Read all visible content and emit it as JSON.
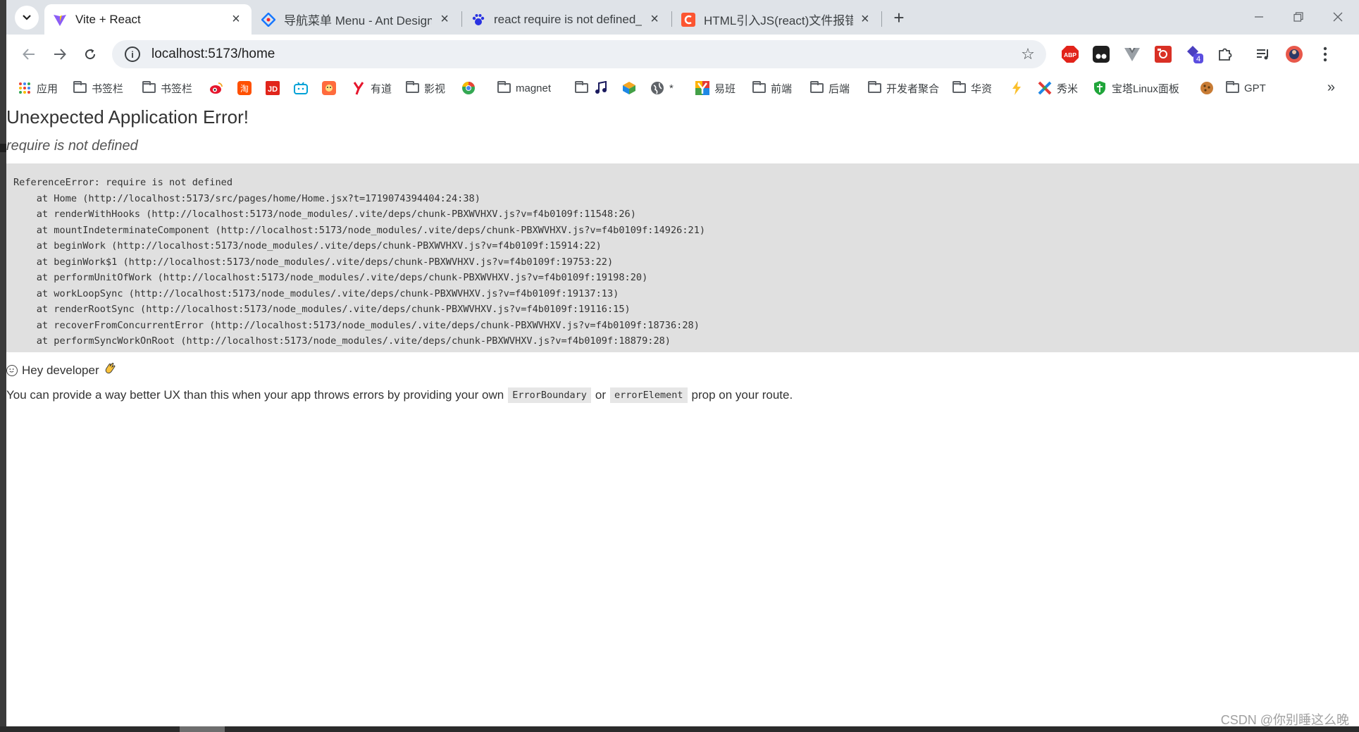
{
  "browser": {
    "tabs": [
      {
        "title": "Vite + React",
        "active": true
      },
      {
        "title": "导航菜单 Menu - Ant Design",
        "active": false
      },
      {
        "title": "react require is not defined_",
        "active": false
      },
      {
        "title": "HTML引入JS(react)文件报错re",
        "active": false
      }
    ],
    "address": "localhost:5173/home",
    "extension_badge": "4",
    "extension_abp": "ABP",
    "bookmarks": [
      {
        "label": "应用",
        "icon": "apps-grid-icon"
      },
      {
        "label": "书签栏",
        "icon": "folder-icon"
      },
      {
        "label": "书签栏",
        "icon": "folder-icon"
      },
      {
        "label": "",
        "icon": "weibo-icon"
      },
      {
        "label": "",
        "icon": "taobao-icon"
      },
      {
        "label": "",
        "icon": "jd-icon"
      },
      {
        "label": "",
        "icon": "bilibili-icon"
      },
      {
        "label": "",
        "icon": "game-icon"
      },
      {
        "label": "有道",
        "icon": "youdao-icon"
      },
      {
        "label": "影视",
        "icon": "folder-icon"
      },
      {
        "label": "",
        "icon": "chrome-icon"
      },
      {
        "label": "magnet",
        "icon": "folder-icon"
      },
      {
        "label": "",
        "icon": "folder-icon"
      },
      {
        "label": "",
        "icon": "music-icon"
      },
      {
        "label": "",
        "icon": "cube-icon"
      },
      {
        "label": "*",
        "icon": "globe-icon"
      },
      {
        "label": "易班",
        "icon": "yiban-icon"
      },
      {
        "label": "前端",
        "icon": "folder-icon"
      },
      {
        "label": "后端",
        "icon": "folder-icon"
      },
      {
        "label": "开发者聚合",
        "icon": "folder-icon"
      },
      {
        "label": "华资",
        "icon": "folder-icon"
      },
      {
        "label": "",
        "icon": "bolt-icon"
      },
      {
        "label": "秀米",
        "icon": "xiumi-icon"
      },
      {
        "label": "宝塔Linux面板",
        "icon": "baota-icon"
      },
      {
        "label": "",
        "icon": "cookie-icon"
      },
      {
        "label": "GPT",
        "icon": "folder-icon"
      }
    ]
  },
  "page": {
    "heading": "Unexpected Application Error!",
    "message": "require is not defined",
    "stack_lines": [
      "ReferenceError: require is not defined",
      "    at Home (http://localhost:5173/src/pages/home/Home.jsx?t=1719074394404:24:38)",
      "    at renderWithHooks (http://localhost:5173/node_modules/.vite/deps/chunk-PBXWVHXV.js?v=f4b0109f:11548:26)",
      "    at mountIndeterminateComponent (http://localhost:5173/node_modules/.vite/deps/chunk-PBXWVHXV.js?v=f4b0109f:14926:21)",
      "    at beginWork (http://localhost:5173/node_modules/.vite/deps/chunk-PBXWVHXV.js?v=f4b0109f:15914:22)",
      "    at beginWork$1 (http://localhost:5173/node_modules/.vite/deps/chunk-PBXWVHXV.js?v=f4b0109f:19753:22)",
      "    at performUnitOfWork (http://localhost:5173/node_modules/.vite/deps/chunk-PBXWVHXV.js?v=f4b0109f:19198:20)",
      "    at workLoopSync (http://localhost:5173/node_modules/.vite/deps/chunk-PBXWVHXV.js?v=f4b0109f:19137:13)",
      "    at renderRootSync (http://localhost:5173/node_modules/.vite/deps/chunk-PBXWVHXV.js?v=f4b0109f:19116:15)",
      "    at recoverFromConcurrentError (http://localhost:5173/node_modules/.vite/deps/chunk-PBXWVHXV.js?v=f4b0109f:18736:28)",
      "    at performSyncWorkOnRoot (http://localhost:5173/node_modules/.vite/deps/chunk-PBXWVHXV.js?v=f4b0109f:18879:28)"
    ],
    "hey_text": "Hey developer",
    "tip_before": "You can provide a way better UX than this when your app throws errors by providing your own",
    "tip_code1": "ErrorBoundary",
    "tip_or": "or",
    "tip_code2": "errorElement",
    "tip_after": "prop on your route."
  },
  "watermark": "CSDN @你别睡这么晚"
}
